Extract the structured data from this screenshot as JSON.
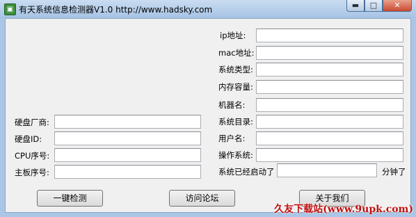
{
  "window": {
    "title": "有天系统信息检测器V1.0  http://www.hadsky.com",
    "minimize_glyph": "▬",
    "maximize_glyph": "□",
    "close_glyph": "✕",
    "app_icon": "system-info-icon"
  },
  "left_fields": {
    "disk_vendor": {
      "label": "硬盘厂商:",
      "value": ""
    },
    "disk_id": {
      "label": "硬盘ID:",
      "value": ""
    },
    "cpu_serial": {
      "label": "CPU序号:",
      "value": ""
    },
    "board_serial": {
      "label": "主板序号:",
      "value": ""
    }
  },
  "right_fields": {
    "ip": {
      "label": "ip地址:",
      "value": ""
    },
    "mac": {
      "label": "mac地址:",
      "value": ""
    },
    "system_type": {
      "label": "系统类型:",
      "value": ""
    },
    "memory": {
      "label": "内存容量:",
      "value": ""
    },
    "machine_name": {
      "label": "机器名:",
      "value": ""
    },
    "system_dir": {
      "label": "系统目录:",
      "value": ""
    },
    "username": {
      "label": "用户名:",
      "value": ""
    },
    "os": {
      "label": "操作系统:",
      "value": ""
    },
    "uptime": {
      "label": "系统已经启动了",
      "value": "",
      "unit": "分钟了"
    }
  },
  "buttons": {
    "detect": "一键检测",
    "forum": "访问论坛",
    "about": "关于我们"
  },
  "watermark": "久友下载站(www.9upk.com)"
}
